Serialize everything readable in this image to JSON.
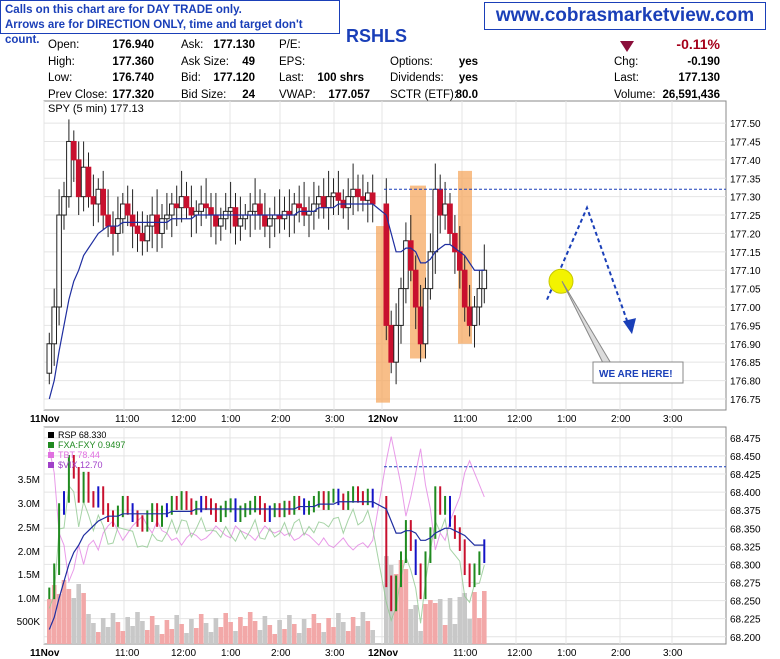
{
  "notice": {
    "line1": "Calls on this chart are for DAY TRADE only.",
    "line2": "Arrows are for DIRECTION ONLY, time and target don't count."
  },
  "site": "www.cobrasmarketview.com",
  "ticker": "RSHLS",
  "quote": {
    "open": {
      "label": "Open:",
      "value": "176.940"
    },
    "high": {
      "label": "High:",
      "value": "177.360"
    },
    "low": {
      "label": "Low:",
      "value": "176.740"
    },
    "prev_close": {
      "label": "Prev Close:",
      "value": "177.320"
    },
    "ask": {
      "label": "Ask:",
      "value": "177.130"
    },
    "ask_size": {
      "label": "Ask Size:",
      "value": "49"
    },
    "bid": {
      "label": "Bid:",
      "value": "177.120"
    },
    "bid_size": {
      "label": "Bid Size:",
      "value": "24"
    },
    "pe": {
      "label": "P/E:",
      "value": ""
    },
    "eps": {
      "label": "EPS:",
      "value": ""
    },
    "last_shrs": {
      "label": "Last:",
      "value": "100 shrs"
    },
    "vwap": {
      "label": "VWAP:",
      "value": "177.057"
    },
    "options": {
      "label": "Options:",
      "value": "yes"
    },
    "dividends": {
      "label": "Dividends:",
      "value": "yes"
    },
    "sctr": {
      "label": "SCTR (ETF):",
      "value": "80.0"
    },
    "pct_change": "-0.11%",
    "chg": {
      "label": "Chg:",
      "value": "-0.190"
    },
    "last": {
      "label": "Last:",
      "value": "177.130"
    },
    "volume": {
      "label": "Volume:",
      "value": "26,591,436"
    }
  },
  "colors": {
    "up": "#208a20",
    "down": "#c8102e",
    "ma": "#1f2ea0",
    "annotation": "#1a3fb8",
    "box": "#f5a860",
    "vol": "#c8c8c8",
    "vol_up": "#f2a8a8",
    "blue_bar": "#1414c8",
    "magenta": "#e070e0"
  },
  "chart_data": [
    {
      "type": "candlestick",
      "title": "SPY (5 min) 177.13",
      "interval": "5 min",
      "ylim": [
        176.72,
        177.56
      ],
      "y_ticks": [
        177.5,
        177.45,
        177.4,
        177.35,
        177.3,
        177.25,
        177.2,
        177.15,
        177.1,
        177.05,
        177.0,
        176.95,
        176.9,
        176.85,
        176.8,
        176.75
      ],
      "x_ticks": [
        "11Nov",
        "11:00",
        "12:00",
        "1:00",
        "2:00",
        "3:00",
        "12Nov",
        "11:00",
        "12:00",
        "1:00",
        "2:00",
        "3:00"
      ],
      "prev_close_line": 177.32,
      "close_series": [
        176.9,
        177.0,
        177.25,
        177.3,
        177.45,
        177.4,
        177.3,
        177.38,
        177.3,
        177.28,
        177.32,
        177.25,
        177.22,
        177.2,
        177.24,
        177.28,
        177.25,
        177.22,
        177.2,
        177.18,
        177.22,
        177.25,
        177.2,
        177.24,
        177.25,
        177.28,
        177.27,
        177.3,
        177.27,
        177.25,
        177.26,
        177.28,
        177.27,
        177.25,
        177.22,
        177.24,
        177.26,
        177.27,
        177.22,
        177.24,
        177.25,
        177.26,
        177.28,
        177.25,
        177.22,
        177.24,
        177.25,
        177.24,
        177.26,
        177.25,
        177.28,
        177.27,
        177.25,
        177.26,
        177.28,
        177.3,
        177.27,
        177.3,
        177.31,
        177.29,
        177.27,
        177.3,
        177.32,
        177.3,
        177.29,
        177.31,
        177.28,
        176.95,
        176.85,
        176.95,
        177.05,
        177.18,
        177.1,
        177.0,
        176.9,
        177.05,
        177.15,
        177.32,
        177.25,
        177.28,
        177.2,
        177.15,
        177.1,
        177.0,
        176.95,
        177.0,
        177.05,
        177.1
      ],
      "ma_series": [
        176.75,
        176.8,
        176.88,
        176.95,
        177.02,
        177.07,
        177.1,
        177.14,
        177.16,
        177.18,
        177.2,
        177.21,
        177.22,
        177.22,
        177.22,
        177.23,
        177.23,
        177.23,
        177.23,
        177.23,
        177.23,
        177.23,
        177.23,
        177.23,
        177.23,
        177.24,
        177.24,
        177.24,
        177.24,
        177.24,
        177.25,
        177.25,
        177.25,
        177.25,
        177.25,
        177.25,
        177.25,
        177.25,
        177.25,
        177.25,
        177.25,
        177.25,
        177.25,
        177.25,
        177.25,
        177.25,
        177.25,
        177.25,
        177.25,
        177.25,
        177.25,
        177.26,
        177.26,
        177.26,
        177.26,
        177.27,
        177.27,
        177.27,
        177.27,
        177.28,
        177.28,
        177.28,
        177.28,
        177.28,
        177.28,
        177.28,
        177.28,
        177.25,
        177.2,
        177.15,
        177.15,
        177.16,
        177.16,
        177.15,
        177.12,
        177.12,
        177.13,
        177.15,
        177.16,
        177.17,
        177.17,
        177.16,
        177.15,
        177.14,
        177.12,
        177.1,
        177.1,
        177.1
      ],
      "arrow_path": [
        [
          "12:40",
          177.02
        ],
        [
          "1:20",
          177.27
        ],
        [
          "1:55",
          176.94
        ]
      ],
      "annotation": "WE ARE HERE!",
      "highlight_boxes": [
        {
          "x_from": "12Nov",
          "x_to": "12Nov+5m",
          "y_from": 176.74,
          "y_to": 177.22
        },
        {
          "x_from": "10:15",
          "x_to": "10:30",
          "y_from": 176.86,
          "y_to": 177.33
        },
        {
          "x_from": "10:55",
          "x_to": "11:05",
          "y_from": 176.9,
          "y_to": 177.37
        }
      ]
    },
    {
      "type": "bar",
      "title": "RSP 68.330",
      "series": [
        {
          "name": "RSP",
          "value": "68.330"
        },
        {
          "name": "FXA:FXY",
          "value": "0.9497"
        },
        {
          "name": "TBT",
          "value": "78.44"
        },
        {
          "name": "$VIX",
          "value": "12.70"
        }
      ],
      "ylim": [
        68.19,
        68.49
      ],
      "y_ticks": [
        68.475,
        68.45,
        68.425,
        68.4,
        68.375,
        68.35,
        68.325,
        68.3,
        68.275,
        68.25,
        68.225,
        68.2
      ],
      "volume_ticks": [
        "3.5M",
        "3.0M",
        "2.5M",
        "2.0M",
        "1.5M",
        "1.0M",
        "500K"
      ],
      "x_ticks": [
        "11Nov",
        "11:00",
        "12:00",
        "1:00",
        "2:00",
        "3:00",
        "12Nov",
        "11:00",
        "12:00",
        "1:00",
        "2:00",
        "3:00"
      ],
      "prev_close_line": 68.435
    }
  ]
}
